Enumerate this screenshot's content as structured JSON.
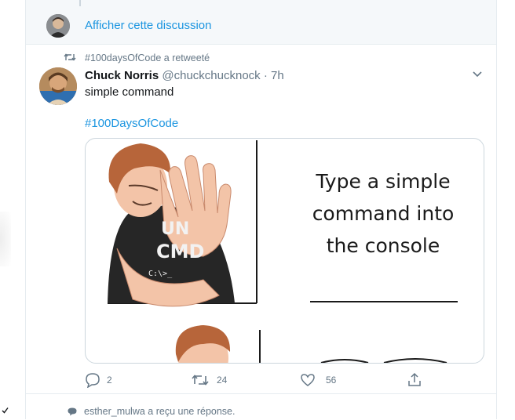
{
  "thread": {
    "link_label": "Afficher cette discussion"
  },
  "retweet": {
    "text": "#100daysOfCode a retweeté"
  },
  "tweet": {
    "display_name": "Chuck Norris",
    "handle": "@chuckchucknock",
    "separator": "·",
    "time": "7h",
    "text": "simple command",
    "hashtag": "#100DaysOfCode",
    "meme": {
      "top_panel_text": [
        "Type a simple",
        "command into",
        "the console"
      ],
      "shirt_text": [
        "UN",
        "CMD",
        "C:\\>_"
      ]
    },
    "actions": {
      "reply_count": "2",
      "retweet_count": "24",
      "like_count": "56"
    }
  },
  "reply_notice": {
    "text": "esther_mulwa a reçu une réponse."
  },
  "colors": {
    "link": "#1b95e0",
    "secondary_text": "#657786",
    "border": "#e6ecf0",
    "thread_bg": "#f5f8fa"
  },
  "icons": [
    "retweet-icon",
    "caret-down-icon",
    "reply-icon",
    "like-icon",
    "share-icon",
    "speech-bubble-icon",
    "check-icon"
  ]
}
